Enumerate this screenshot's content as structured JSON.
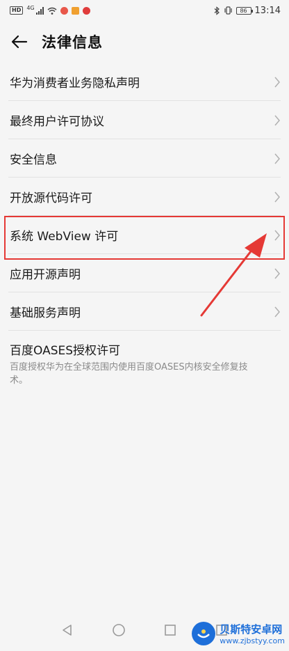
{
  "status_bar": {
    "hd": "HD",
    "network": "4G",
    "time": "13:14",
    "battery": "86"
  },
  "header": {
    "title": "法律信息"
  },
  "items": [
    {
      "label": "华为消费者业务隐私声明"
    },
    {
      "label": "最终用户许可协议"
    },
    {
      "label": "安全信息"
    },
    {
      "label": "开放源代码许可"
    },
    {
      "label": "系统 WebView 许可"
    },
    {
      "label": "应用开源声明"
    },
    {
      "label": "基础服务声明"
    }
  ],
  "oases": {
    "label": "百度OASES授权许可",
    "desc": "百度授权华为在全球范围内使用百度OASES内核安全修复技术。"
  },
  "watermark": {
    "name": "贝斯特安卓网",
    "url": "www.zjbstyy.com"
  },
  "colors": {
    "highlight": "#e53935",
    "watermark": "#1e6fd9"
  }
}
